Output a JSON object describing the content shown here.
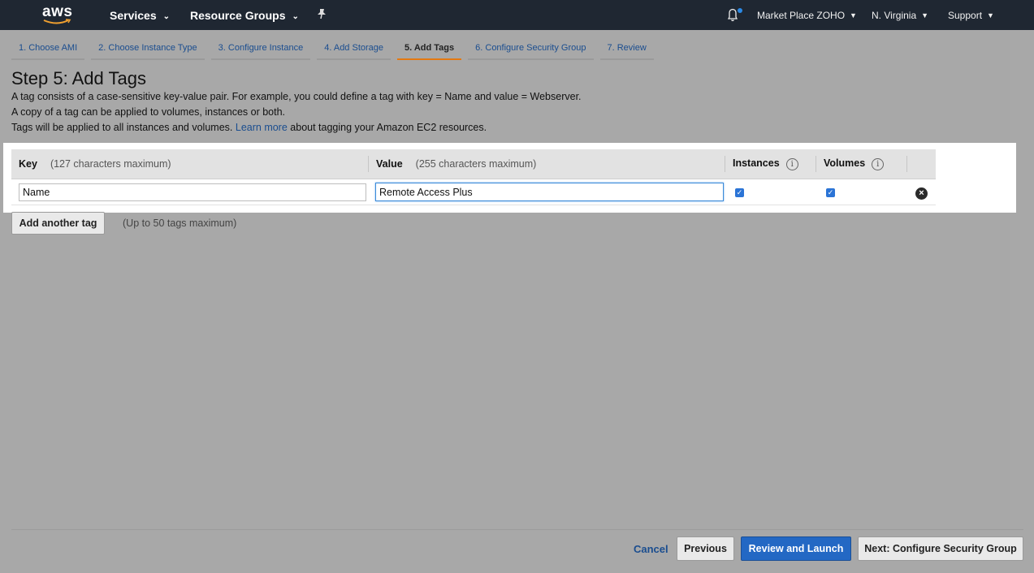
{
  "topnav": {
    "logo": "aws",
    "services": "Services",
    "resource_groups": "Resource Groups",
    "pin_icon": "pin-icon",
    "account": "Market Place ZOHO",
    "region": "N. Virginia",
    "support": "Support"
  },
  "wizard": {
    "tabs": [
      {
        "label": "1. Choose AMI",
        "active": false
      },
      {
        "label": "2. Choose Instance Type",
        "active": false
      },
      {
        "label": "3. Configure Instance",
        "active": false
      },
      {
        "label": "4. Add Storage",
        "active": false
      },
      {
        "label": "5. Add Tags",
        "active": true
      },
      {
        "label": "6. Configure Security Group",
        "active": false
      },
      {
        "label": "7. Review",
        "active": false
      }
    ]
  },
  "page": {
    "title": "Step 5: Add Tags",
    "desc_line1": "A tag consists of a case-sensitive key-value pair. For example, you could define a tag with key = Name and value = Webserver.",
    "desc_line2": "A copy of a tag can be applied to volumes, instances or both.",
    "desc_line3_before": "Tags will be applied to all instances and volumes.",
    "learn_more": "Learn more",
    "desc_line3_after": "about tagging your Amazon EC2 resources."
  },
  "table": {
    "headers": {
      "key": "Key",
      "key_hint": "(127 characters maximum)",
      "value": "Value",
      "value_hint": "(255 characters maximum)",
      "instances": "Instances",
      "volumes": "Volumes"
    },
    "rows": [
      {
        "key": "Name",
        "value": "Remote Access Plus",
        "instances": true,
        "volumes": true
      }
    ]
  },
  "add_tag": {
    "button": "Add another tag",
    "note": "(Up to 50 tags maximum)"
  },
  "footer": {
    "cancel": "Cancel",
    "previous": "Previous",
    "review_launch": "Review and Launch",
    "next": "Next: Configure Security Group"
  },
  "colors": {
    "nav_bg": "#1f2732",
    "accent_orange": "#e47911",
    "primary_blue": "#2368c4",
    "link_blue": "#1a4d8f",
    "notification_dot": "#2b8ae6"
  }
}
